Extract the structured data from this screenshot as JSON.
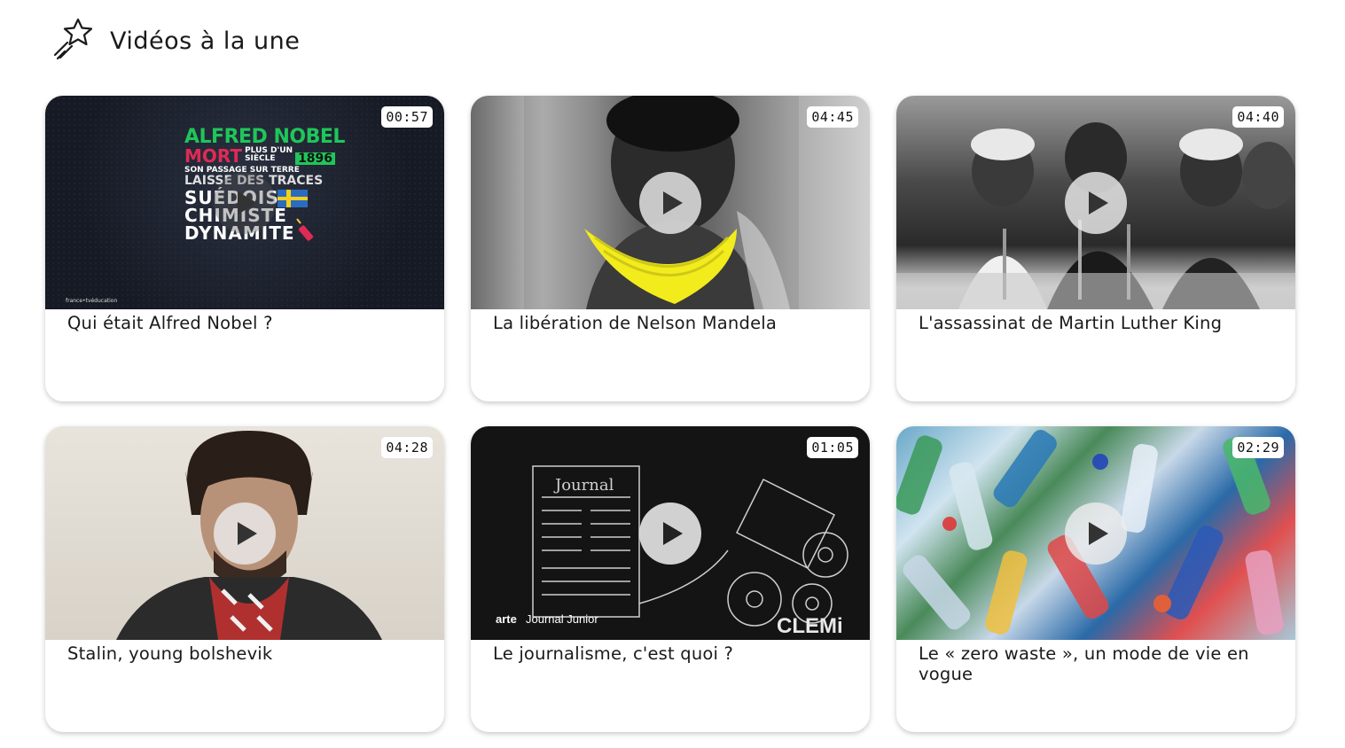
{
  "section": {
    "title": "Vidéos à la une",
    "icon": "shooting-star-icon"
  },
  "videos": [
    {
      "title": "Qui était Alfred Nobel ?",
      "duration": "00:57",
      "thumb_text": {
        "l1": "ALFRED NOBEL",
        "l2": "MORT",
        "l2b1": "PLUS D'UN",
        "l2b2": "SIÈCLE",
        "yr": "1896",
        "l3": "SON PASSAGE SUR TERRE",
        "l4": "LAISSE DES TRACES",
        "b1": "SUÉDOIS",
        "b2": "CHIMISTE",
        "b3": "DYNAMITE",
        "logo": "france•tvéducation"
      }
    },
    {
      "title": "La libération de Nelson Mandela",
      "duration": "04:45"
    },
    {
      "title": "L'assassinat de Martin Luther King",
      "duration": "04:40"
    },
    {
      "title": "Stalin, young bolshevik",
      "duration": "04:28"
    },
    {
      "title": "Le journalisme, c'est quoi ?",
      "duration": "01:05",
      "thumb_text": {
        "newspaper": "Journal",
        "brand": "arte",
        "show": "Journal Junior",
        "logo": "CLEMi"
      }
    },
    {
      "title": "Le « zero waste », un mode de vie en vogue",
      "duration": "02:29"
    }
  ],
  "colors": {
    "accent_green": "#1fc65a",
    "accent_red": "#e02a55",
    "highlight_yellow": "#f2ec1c"
  }
}
